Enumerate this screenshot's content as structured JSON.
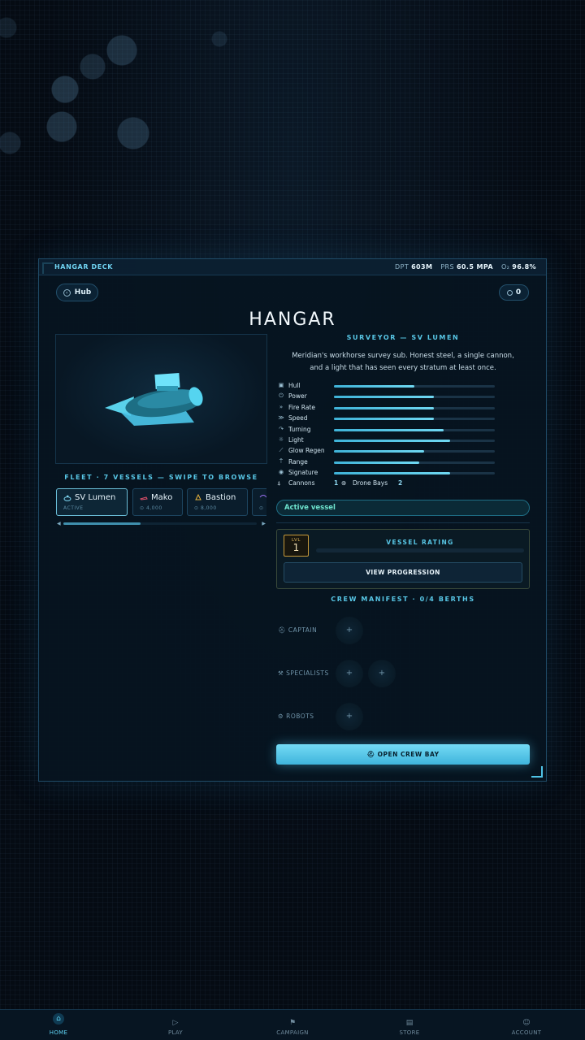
{
  "top_bar": {
    "deck_label": "HANGAR DECK",
    "dpt_label": "DPT",
    "dpt_value": "603M",
    "prs_label": "PRS",
    "prs_value": "60.5 MPA",
    "o2_label": "O₂",
    "o2_value": "96.8%"
  },
  "hub_button": {
    "label": "Hub"
  },
  "currency": {
    "value": "0"
  },
  "title": "HANGAR",
  "vessel_class": "SURVEYOR — SV LUMEN",
  "description": "Meridian's workhorse survey sub. Honest steel, a single cannon, and a light that has seen every stratum at least once.",
  "stats": [
    {
      "label": "Hull",
      "icon": "hull-icon",
      "glyph": "▣",
      "value": 0.5
    },
    {
      "label": "Power",
      "icon": "power-icon",
      "glyph": "⏻",
      "value": 0.62
    },
    {
      "label": "Fire Rate",
      "icon": "fire-rate-icon",
      "glyph": "»",
      "value": 0.62
    },
    {
      "label": "Speed",
      "icon": "speed-icon",
      "glyph": "≫",
      "value": 0.62
    },
    {
      "label": "Turning",
      "icon": "turning-icon",
      "glyph": "↷",
      "value": 0.68
    },
    {
      "label": "Light",
      "icon": "light-icon",
      "glyph": "☼",
      "value": 0.72
    },
    {
      "label": "Glow Regen",
      "icon": "glow-regen-icon",
      "glyph": "⟋",
      "value": 0.56
    },
    {
      "label": "Range",
      "icon": "range-icon",
      "glyph": "⍑",
      "value": 0.53
    },
    {
      "label": "Signature",
      "icon": "signature-icon",
      "glyph": "◉",
      "value": 0.72
    }
  ],
  "weapons": {
    "cannons_label": "Cannons",
    "cannons_value": "1",
    "drone_bays_label": "Drone Bays",
    "drone_bays_value": "2"
  },
  "active_vessel_label": "Active vessel",
  "rating": {
    "lvl_label": "LVL",
    "lvl_value": "1",
    "label": "VESSEL RATING",
    "progress": 0,
    "button": "VIEW PROGRESSION"
  },
  "fleet": {
    "label": "FLEET · 7 VESSELS — SWIPE TO BROWSE",
    "vessels": [
      {
        "name": "SV Lumen",
        "sub": "ACTIVE",
        "color": "#7fd8f3",
        "active": true
      },
      {
        "name": "Mako",
        "sub": "4,000",
        "color": "#e0506a",
        "active": false
      },
      {
        "name": "Bastion",
        "sub": "8,000",
        "color": "#e7b23c",
        "active": false
      },
      {
        "name": "",
        "sub": "",
        "color": "#9a6ff0",
        "active": false
      }
    ],
    "scroll_position": 0.4
  },
  "crew": {
    "label": "CREW MANIFEST · 0/4 BERTHS",
    "rows": [
      {
        "label": "CAPTAIN",
        "slots": 1
      },
      {
        "label": "SPECIALISTS",
        "slots": 2
      },
      {
        "label": "ROBOTS",
        "slots": 1
      }
    ],
    "slot_glyph": "+",
    "open_button": "OPEN CREW BAY"
  },
  "nav": {
    "items": [
      {
        "label": "HOME",
        "icon": "home-icon",
        "glyph": "⌂",
        "active": true
      },
      {
        "label": "PLAY",
        "icon": "play-icon",
        "glyph": "▷",
        "active": false
      },
      {
        "label": "CAMPAIGN",
        "icon": "campaign-icon",
        "glyph": "⚑",
        "active": false
      },
      {
        "label": "STORE",
        "icon": "store-icon",
        "glyph": "▤",
        "active": false
      },
      {
        "label": "ACCOUNT",
        "icon": "account-icon",
        "glyph": "☺",
        "active": false
      }
    ]
  },
  "colors": {
    "accent": "#58c7e6",
    "active_green": "#6fe6d0",
    "level_gold": "#c79a3a",
    "button_primary": "#5cc8ea"
  }
}
